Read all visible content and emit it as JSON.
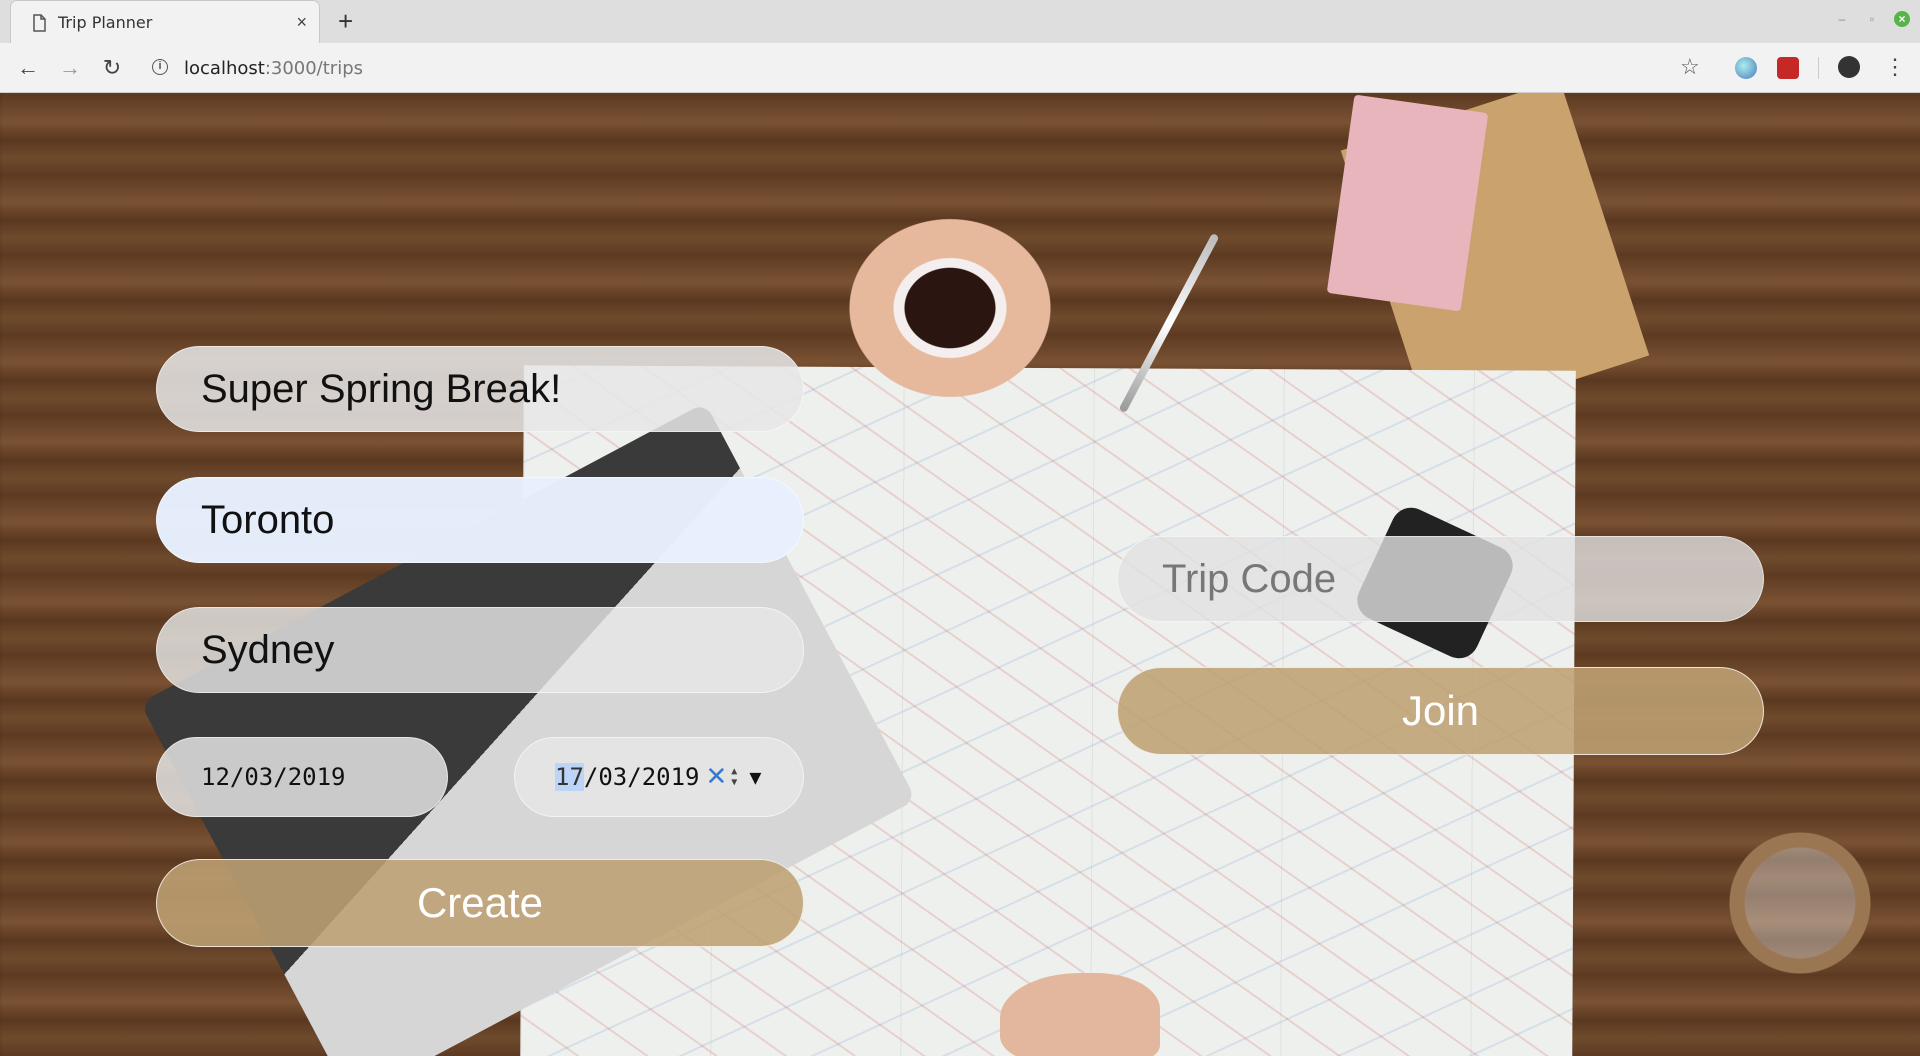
{
  "browser": {
    "tab_title": "Trip Planner",
    "tab_close": "×",
    "new_tab": "+",
    "url_host": "localhost",
    "url_path": ":3000/trips",
    "window_controls": {
      "minimize": "–",
      "restore": "▫",
      "close": "×"
    }
  },
  "create_form": {
    "trip_name_value": "Super Spring Break!",
    "origin_value": "Toronto",
    "destination_value": "Sydney",
    "start_date": "12/03/2019",
    "end_date_day": "17",
    "end_date_rest": "/03/2019",
    "create_label": "Create"
  },
  "join_form": {
    "trip_code_placeholder": "Trip Code",
    "join_label": "Join"
  },
  "icons": {
    "back": "back-arrow-icon",
    "forward": "forward-arrow-icon",
    "reload": "reload-icon",
    "info": "info-icon",
    "star": "bookmark-star-icon",
    "account": "account-icon",
    "menu": "kebab-menu-icon",
    "clear": "clear-x-icon",
    "spin": "spin-arrows-icon",
    "dropdown": "dropdown-triangle-icon"
  },
  "colors": {
    "button_tan": "#bea073",
    "focused_input": "#e8f0fe",
    "date_selection": "#bcd4f5"
  }
}
